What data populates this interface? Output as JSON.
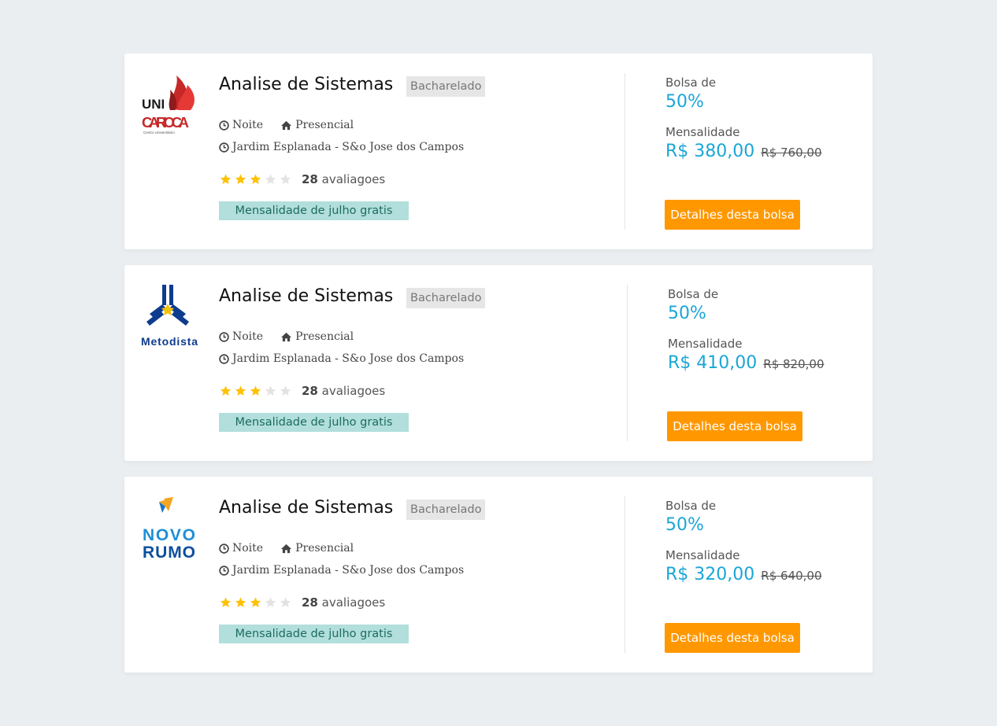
{
  "colors": {
    "accent": "#1aa6d6",
    "button": "#ff9800",
    "promo_bg": "#b2dfdb",
    "star": "#ffc107"
  },
  "cards": [
    {
      "logo": "unicarioca-logo",
      "logo_text": [
        "UNI",
        "CARIOCA",
        "Centro Universitário"
      ],
      "title": "Analise de Sistemas",
      "degree": "Bacharelado",
      "shift": "Noite",
      "modality": "Presencial",
      "campus": "Jardim Esplanada - S&o Jose dos Campos",
      "rating": 3,
      "reviews_count": "28",
      "reviews_label": "avaliagoes",
      "promo": "Mensalidade de julho gratis",
      "bolsa_label": "Bolsa de",
      "bolsa_value": "50%",
      "mensalidade_label": "Mensalidade",
      "price": "R$ 380,00",
      "old_price": "R$ 760,00",
      "button": "Detalhes desta bolsa"
    },
    {
      "logo": "metodista-logo",
      "logo_text": [
        "Metodista"
      ],
      "title": "Analise de Sistemas",
      "degree": "Bacharelado",
      "shift": "Noite",
      "modality": "Presencial",
      "campus": "Jardim Esplanada - S&o Jose dos Campos",
      "rating": 3,
      "reviews_count": "28",
      "reviews_label": "avaliagoes",
      "promo": "Mensalidade de julho gratis",
      "bolsa_label": "Bolsa de",
      "bolsa_value": "50%",
      "mensalidade_label": "Mensalidade",
      "price": "R$ 410,00",
      "old_price": "R$ 820,00",
      "button": "Detalhes desta bolsa"
    },
    {
      "logo": "novo-rumo-logo",
      "logo_text": [
        "NOVO",
        "RUMO"
      ],
      "title": "Analise de Sistemas",
      "degree": "Bacharelado",
      "shift": "Noite",
      "modality": "Presencial",
      "campus": "Jardim Esplanada - S&o Jose dos Campos",
      "rating": 3,
      "reviews_count": "28",
      "reviews_label": "avaliagoes",
      "promo": "Mensalidade de julho gratis",
      "bolsa_label": "Bolsa de",
      "bolsa_value": "50%",
      "mensalidade_label": "Mensalidade",
      "price": "R$ 320,00",
      "old_price": "R$ 640,00",
      "button": "Detalhes desta bolsa"
    }
  ]
}
